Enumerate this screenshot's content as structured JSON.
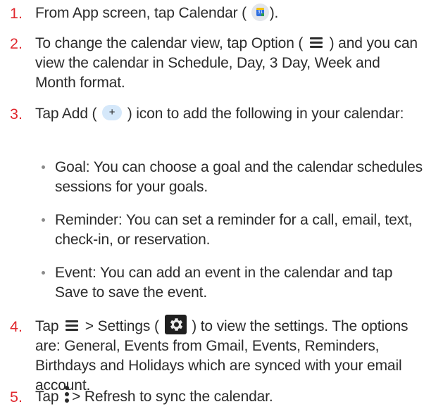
{
  "accent_color": "#e0282e",
  "steps": [
    {
      "number": "1.",
      "parts": [
        "From App screen, tap Calendar (",
        ")."
      ],
      "icon": "calendar-app-icon",
      "icon_text": "31"
    },
    {
      "number": "2.",
      "parts": [
        "To change the calendar view, tap Option (",
        ") and you can view the calendar in Schedule, Day, 3 Day, Week and Month format."
      ],
      "icon": "menu-icon"
    },
    {
      "number": "3.",
      "parts": [
        "Tap Add (",
        ") icon to add the following in your calendar:"
      ],
      "icon": "add-icon",
      "icon_text": "+"
    },
    {
      "number": "4.",
      "parts": [
        "Tap",
        "> Settings (",
        ") to view the settings. The options are: General, Events from Gmail, Events, Reminders, Birthdays and Holidays which are synced with your email account."
      ],
      "icons": [
        "menu-icon",
        "gear-icon"
      ]
    },
    {
      "number": "5.",
      "parts": [
        "Tap",
        "> Refresh to sync the calendar."
      ],
      "icon": "more-vert-icon"
    }
  ],
  "bullets": [
    "Goal: You can choose a goal and the calendar schedules sessions for your goals.",
    "Reminder: You can set a reminder for a call, email, text, check-in, or reservation.",
    "Event: You can add an event in the calendar and tap Save to save the event."
  ]
}
